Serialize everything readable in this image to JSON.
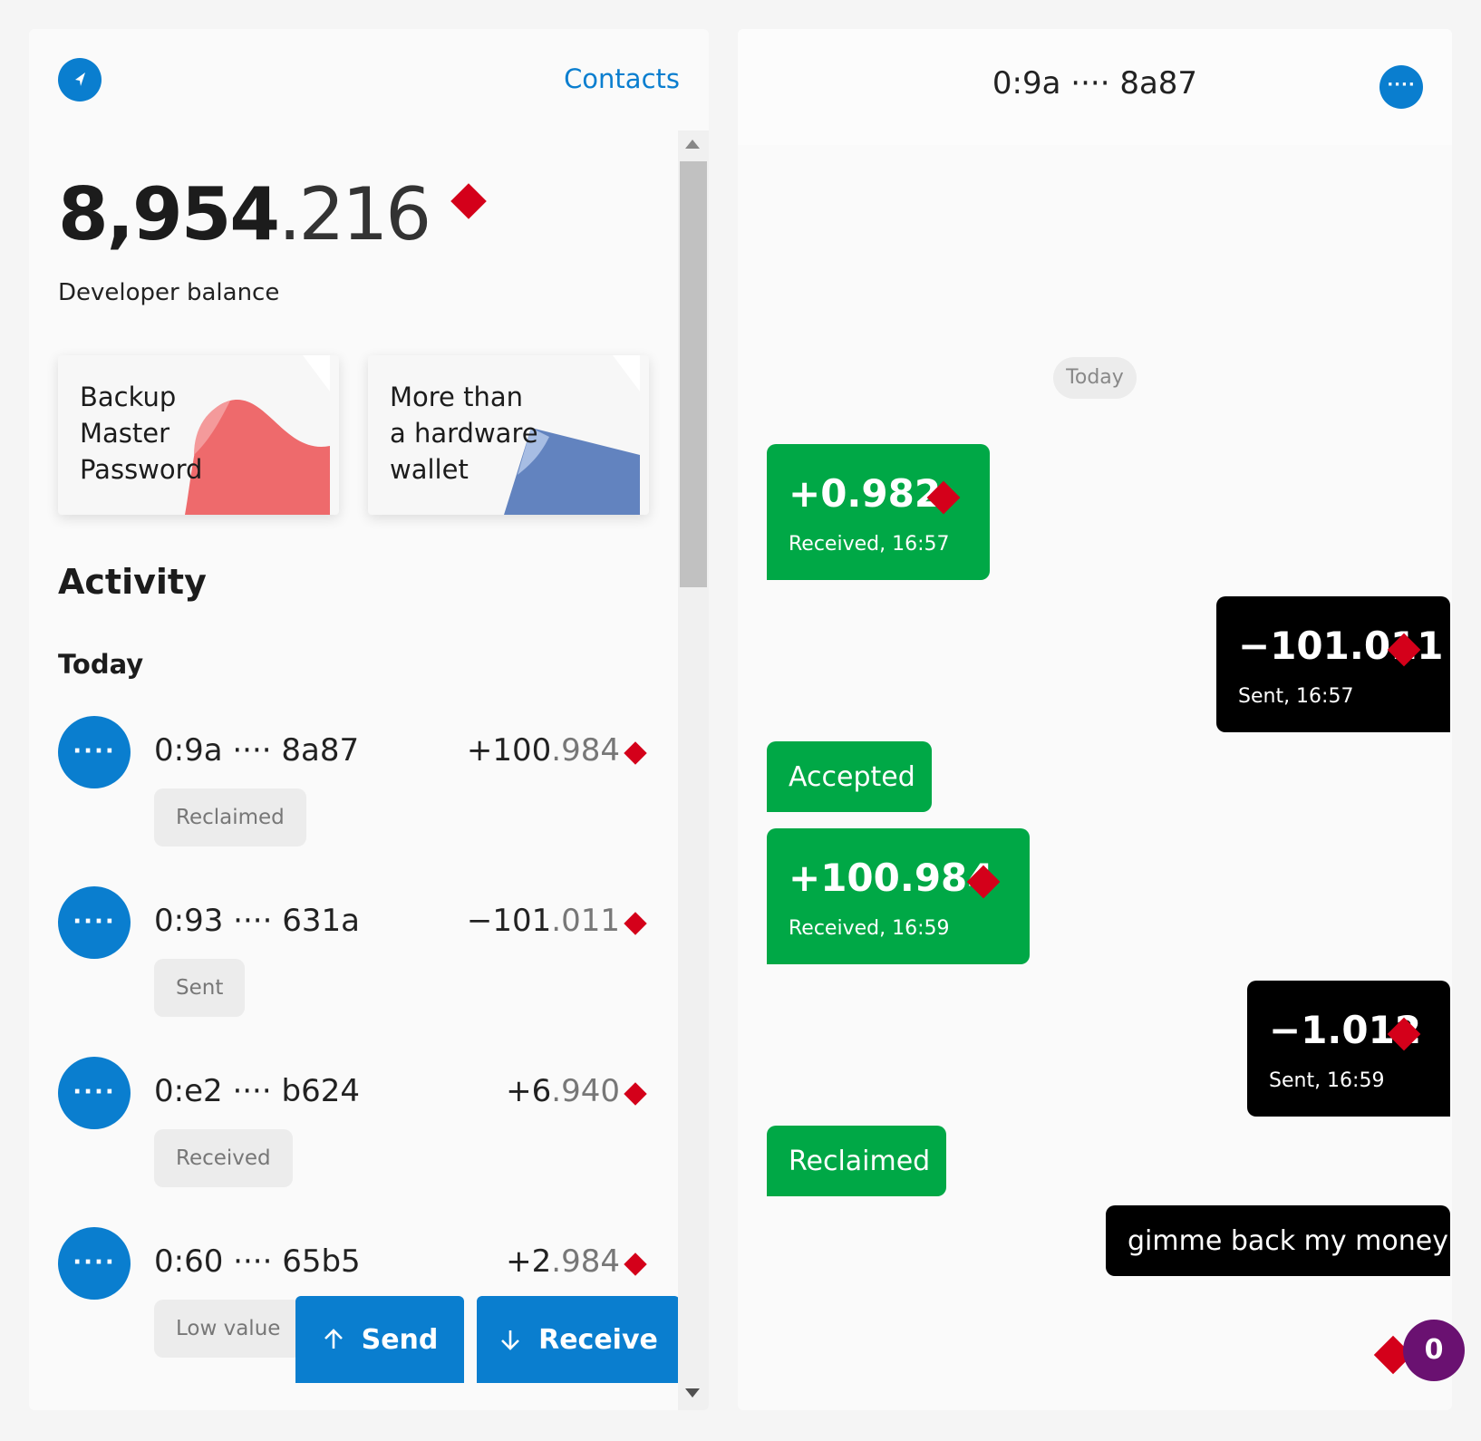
{
  "wallet": {
    "contacts_label": "Contacts",
    "balance_int": "8,954",
    "balance_frac": ".216",
    "balance_label": "Developer balance",
    "cards": [
      {
        "text": "Backup\nMaster\nPassword",
        "color": "#ee6a6c"
      },
      {
        "text": "More than\na hardware\nwallet",
        "color": "#6283bf"
      }
    ],
    "activity_title": "Activity",
    "today_label": "Today",
    "avatar_dots": "····",
    "transactions": [
      {
        "address": "0:9a ···· 8a87",
        "amount_int": "+100",
        "amount_frac": ".984",
        "status": "Reclaimed"
      },
      {
        "address": "0:93 ···· 631a",
        "amount_int": "−101",
        "amount_frac": ".011",
        "status": "Sent"
      },
      {
        "address": "0:e2 ···· b624",
        "amount_int": "+6",
        "amount_frac": ".940",
        "status": "Received"
      },
      {
        "address": "0:60 ···· 65b5",
        "amount_int": "+2",
        "amount_frac": ".984",
        "status": "Low value"
      }
    ],
    "send_label": "Send",
    "receive_label": "Receive"
  },
  "chat": {
    "title": "0:9a ···· 8a87",
    "menu_dots": "····",
    "date_chip": "Today",
    "messages": [
      {
        "amount": "+0.982",
        "subtitle": "Received, 16:57"
      },
      {
        "amount": "−101.011",
        "subtitle": "Sent, 16:57"
      },
      {
        "text": "Accepted"
      },
      {
        "amount": "+100.984",
        "subtitle": "Received, 16:59"
      },
      {
        "amount": "−1.012",
        "subtitle": "Sent, 16:59"
      },
      {
        "text": "Reclaimed"
      },
      {
        "text": "gimme back my money"
      }
    ],
    "badge_count": "0"
  },
  "colors": {
    "accent": "#0a7ecf",
    "received": "#00a846",
    "sent": "#000000",
    "gem": "#d4001a",
    "badge": "#6a1171"
  }
}
